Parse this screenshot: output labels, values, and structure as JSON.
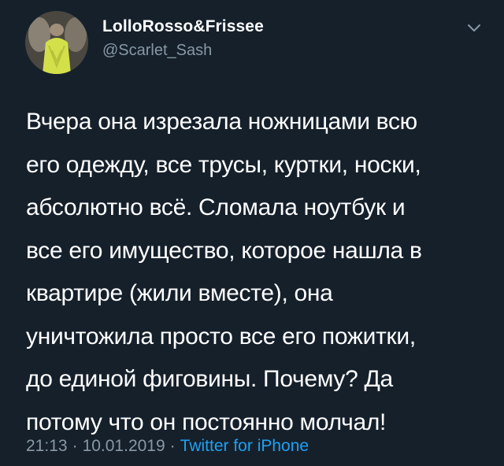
{
  "author": {
    "name": "LolloRosso&Frissee",
    "handle": "@Scarlet_Sash"
  },
  "menu_icon": "chevron-down-icon",
  "tweet": {
    "text": "Вчера она изрезала ножницами всю\nего одежду, все трусы, куртки, носки,\nабсолютно всё. Сломала ноутбук и\nвсе его имущество, которое нашла в\nквартире (жили вместе), она\nуничтожила просто все его пожитки,\nдо единой фиговины. Почему? Да\nпотому что он постоянно молчал!"
  },
  "meta": {
    "time": "21:13",
    "date": "10.01.2019",
    "separator": "·",
    "source": "Twitter for iPhone"
  },
  "colors": {
    "background": "#15202b",
    "text": "#ffffff",
    "secondary": "#8899a6",
    "link": "#1da1f2"
  }
}
